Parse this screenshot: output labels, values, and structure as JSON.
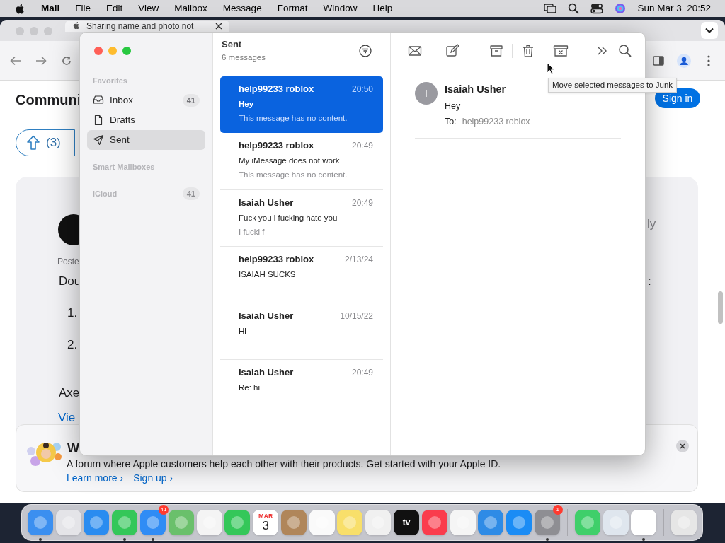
{
  "menu_bar": {
    "app": "Mail",
    "menus": [
      "File",
      "Edit",
      "View",
      "Mailbox",
      "Message",
      "Format",
      "Window",
      "Help"
    ],
    "clock": "Sun Mar 3  20:52"
  },
  "browser": {
    "tab_title": "Sharing name and photo not",
    "heading": "Communi",
    "vote_count": "(3)",
    "sign_in": "Sign in",
    "post_meta": "Poste",
    "post_text": "Dou",
    "list_marks": [
      "1.",
      "2."
    ],
    "author_text": "Axe",
    "view_link": "Vie",
    "reply_hint": "ly",
    "right_text": ":",
    "banner": {
      "title": "W",
      "text": "A forum where Apple customers help each other with their products. Get started with your Apple ID.",
      "links": [
        "Learn more ›",
        "Sign up ›"
      ]
    }
  },
  "mail": {
    "sidebar": [
      {
        "kind": "header",
        "label": "Favorites"
      },
      {
        "kind": "inbox",
        "label": "Inbox",
        "count": "41",
        "selected": false
      },
      {
        "kind": "drafts",
        "label": "Drafts",
        "selected": false
      },
      {
        "kind": "sent",
        "label": "Sent",
        "selected": true
      },
      {
        "kind": "header",
        "label": "Smart Mailboxes"
      },
      {
        "kind": "account",
        "label": "iCloud",
        "count": "41"
      }
    ],
    "list_title": "Sent",
    "list_count": "6 messages",
    "messages": [
      {
        "sender": "help99233 roblox",
        "time": "20:50",
        "subject": "Hey",
        "preview": "This message has no content.",
        "selected": true
      },
      {
        "sender": "help99233 roblox",
        "time": "20:49",
        "subject": "My iMessage does not work",
        "preview": "This message has no content.",
        "selected": false
      },
      {
        "sender": "Isaiah Usher",
        "time": "20:49",
        "subject": "Fuck you i fucking hate you",
        "preview": "I fucki f",
        "selected": false
      },
      {
        "sender": "help99233 roblox",
        "time": "2/13/24",
        "subject": "ISAIAH SUCKS",
        "selected": false
      },
      {
        "sender": "Isaiah Usher",
        "time": "10/15/22",
        "subject": "Hi",
        "selected": false
      },
      {
        "sender": "Isaiah Usher",
        "time": "20:49",
        "subject": "Re: hi",
        "selected": false
      }
    ],
    "reader": {
      "initial": "I",
      "sender": "Isaiah Usher",
      "subject": "Hey",
      "to_label": "To:",
      "to": "help99233 roblox"
    },
    "tooltip": "Move selected messages to Junk"
  },
  "dock": [
    {
      "kind": "app",
      "color": "#3b8ff0",
      "running": true
    },
    {
      "kind": "app",
      "color": "#e4e4e8",
      "running": false
    },
    {
      "kind": "app",
      "color": "#2a8cf0",
      "running": false
    },
    {
      "kind": "app",
      "color": "#34c759",
      "running": true
    },
    {
      "kind": "app",
      "color": "#2f8cf5",
      "running": true,
      "badge": "41"
    },
    {
      "kind": "app",
      "color": "#6ac06b",
      "running": false
    },
    {
      "kind": "app",
      "color": "#f4f4f4",
      "running": false
    },
    {
      "kind": "app",
      "color": "#34c759",
      "running": false
    },
    {
      "kind": "calendar",
      "color": "#ffffff",
      "running": false,
      "month": "MAR",
      "day": "3"
    },
    {
      "kind": "app",
      "color": "#b0865a",
      "running": false
    },
    {
      "kind": "app",
      "color": "#fafafa",
      "running": false
    },
    {
      "kind": "app",
      "color": "#f8df6a",
      "running": false
    },
    {
      "kind": "app",
      "color": "#f0f0f0",
      "running": false
    },
    {
      "kind": "tv",
      "color": "#111111",
      "running": false,
      "label": "tv"
    },
    {
      "kind": "app",
      "color": "#fa3c4d",
      "running": false
    },
    {
      "kind": "app",
      "color": "#f5f5f5",
      "running": false
    },
    {
      "kind": "app",
      "color": "#2e8be6",
      "running": false
    },
    {
      "kind": "app",
      "color": "#1a8cf5",
      "running": false
    },
    {
      "kind": "app",
      "color": "#8e8e93",
      "running": true,
      "badge": "1"
    },
    {
      "kind": "separator"
    },
    {
      "kind": "app",
      "color": "#3fcf6a",
      "running": false
    },
    {
      "kind": "app",
      "color": "#dfe6ee",
      "running": false
    },
    {
      "kind": "app",
      "color": "#ffffff",
      "running": true
    },
    {
      "kind": "separator"
    },
    {
      "kind": "app",
      "color": "#e6e6e6",
      "running": false
    }
  ]
}
